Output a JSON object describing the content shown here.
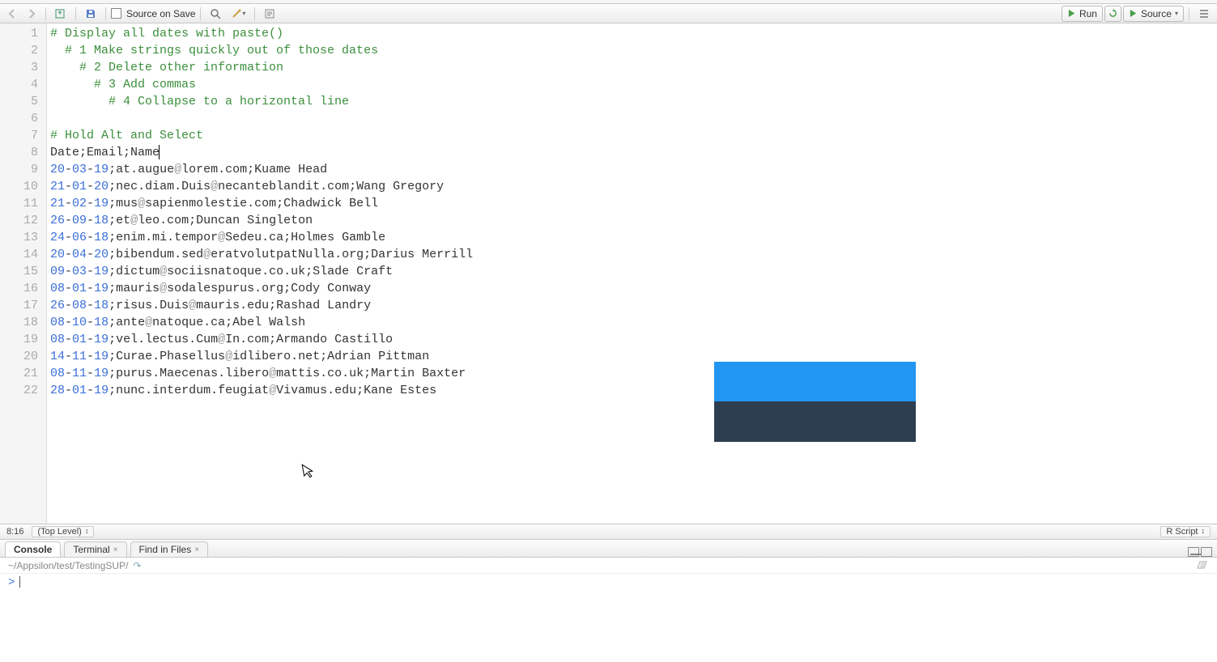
{
  "toolbar": {
    "source_on_save_label": "Source on Save",
    "run_label": "Run",
    "source_label": "Source"
  },
  "code": {
    "lines": [
      {
        "n": 1,
        "comment": "# Display all dates with paste()"
      },
      {
        "n": 2,
        "comment": "  # 1 Make strings quickly out of those dates"
      },
      {
        "n": 3,
        "comment": "    # 2 Delete other information"
      },
      {
        "n": 4,
        "comment": "      # 3 Add commas"
      },
      {
        "n": 5,
        "comment": "        # 4 Collapse to a horizontal line"
      },
      {
        "n": 6,
        "plain": ""
      },
      {
        "n": 7,
        "comment": "# Hold Alt and Select"
      },
      {
        "n": 8,
        "plain": "Date;Email;Name",
        "cursor": true
      },
      {
        "n": 9,
        "d1": "20",
        "d2": "03",
        "d3": "19",
        "email": "at.augue",
        "dom": "lorem.com",
        "name": "Kuame Head"
      },
      {
        "n": 10,
        "d1": "21",
        "d2": "01",
        "d3": "20",
        "email": "nec.diam.Duis",
        "dom": "necanteblandit.com",
        "name": "Wang Gregory"
      },
      {
        "n": 11,
        "d1": "21",
        "d2": "02",
        "d3": "19",
        "email": "mus",
        "dom": "sapienmolestie.com",
        "name": "Chadwick Bell"
      },
      {
        "n": 12,
        "d1": "26",
        "d2": "09",
        "d3": "18",
        "email": "et",
        "dom": "leo.com",
        "name": "Duncan Singleton"
      },
      {
        "n": 13,
        "d1": "24",
        "d2": "06",
        "d3": "18",
        "email": "enim.mi.tempor",
        "dom": "Sedeu.ca",
        "name": "Holmes Gamble"
      },
      {
        "n": 14,
        "d1": "20",
        "d2": "04",
        "d3": "20",
        "email": "bibendum.sed",
        "dom": "eratvolutpatNulla.org",
        "name": "Darius Merrill"
      },
      {
        "n": 15,
        "d1": "09",
        "d2": "03",
        "d3": "19",
        "email": "dictum",
        "dom": "sociisnatoque.co.uk",
        "name": "Slade Craft"
      },
      {
        "n": 16,
        "d1": "08",
        "d2": "01",
        "d3": "19",
        "email": "mauris",
        "dom": "sodalespurus.org",
        "name": "Cody Conway"
      },
      {
        "n": 17,
        "d1": "26",
        "d2": "08",
        "d3": "18",
        "email": "risus.Duis",
        "dom": "mauris.edu",
        "name": "Rashad Landry"
      },
      {
        "n": 18,
        "d1": "08",
        "d2": "10",
        "d3": "18",
        "email": "ante",
        "dom": "natoque.ca",
        "name": "Abel Walsh"
      },
      {
        "n": 19,
        "d1": "08",
        "d2": "01",
        "d3": "19",
        "email": "vel.lectus.Cum",
        "dom": "In.com",
        "name": "Armando Castillo"
      },
      {
        "n": 20,
        "d1": "14",
        "d2": "11",
        "d3": "19",
        "email": "Curae.Phasellus",
        "dom": "idlibero.net",
        "name": "Adrian Pittman"
      },
      {
        "n": 21,
        "d1": "08",
        "d2": "11",
        "d3": "19",
        "email": "purus.Maecenas.libero",
        "dom": "mattis.co.uk",
        "name": "Martin Baxter"
      },
      {
        "n": 22,
        "d1": "28",
        "d2": "01",
        "d3": "19",
        "email": "nunc.interdum.feugiat",
        "dom": "Vivamus.edu",
        "name": "Kane Estes"
      }
    ]
  },
  "statusbar": {
    "pos": "8:16",
    "scope": "(Top Level)",
    "lang": "R Script"
  },
  "bottom_tabs": {
    "console": "Console",
    "terminal": "Terminal",
    "find": "Find in Files"
  },
  "console": {
    "path": "~/Appsilon/test/TestingSUP/",
    "prompt": ">"
  },
  "overlay": {
    "top_color": "#2196f3",
    "bot_color": "#2c3e50"
  }
}
